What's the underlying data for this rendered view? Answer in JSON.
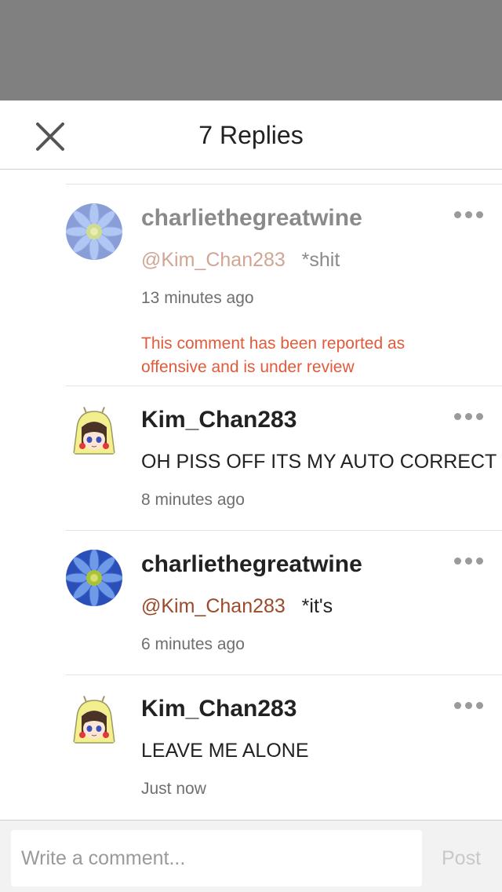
{
  "header": {
    "title": "7 Replies",
    "close_icon": "close-x-icon"
  },
  "comments": [
    {
      "username": "charliethegreatwine",
      "mention": "@Kim_Chan283",
      "text": "*shit",
      "time": "13 minutes ago",
      "report_notice": "This comment has been reported as offensive and is under review",
      "avatar": "blue-flower-avatar",
      "faded": true
    },
    {
      "username": "Kim_Chan283",
      "mention": "",
      "text": "OH PISS OFF ITS MY AUTO CORRECT",
      "time": "8 minutes ago",
      "avatar": "anime-character-avatar"
    },
    {
      "username": "charliethegreatwine",
      "mention": "@Kim_Chan283",
      "text": "*it's",
      "time": "6 minutes ago",
      "avatar": "blue-flower-avatar"
    },
    {
      "username": "Kim_Chan283",
      "mention": "",
      "text": "LEAVE ME ALONE",
      "time": "Just now",
      "avatar": "anime-character-avatar"
    }
  ],
  "composer": {
    "placeholder": "Write a comment...",
    "post_label": "Post"
  },
  "colors": {
    "scrim": "#808080",
    "mention": "#9c4a2a",
    "report": "#e35a3a",
    "post_disabled": "#c8c8c8"
  }
}
